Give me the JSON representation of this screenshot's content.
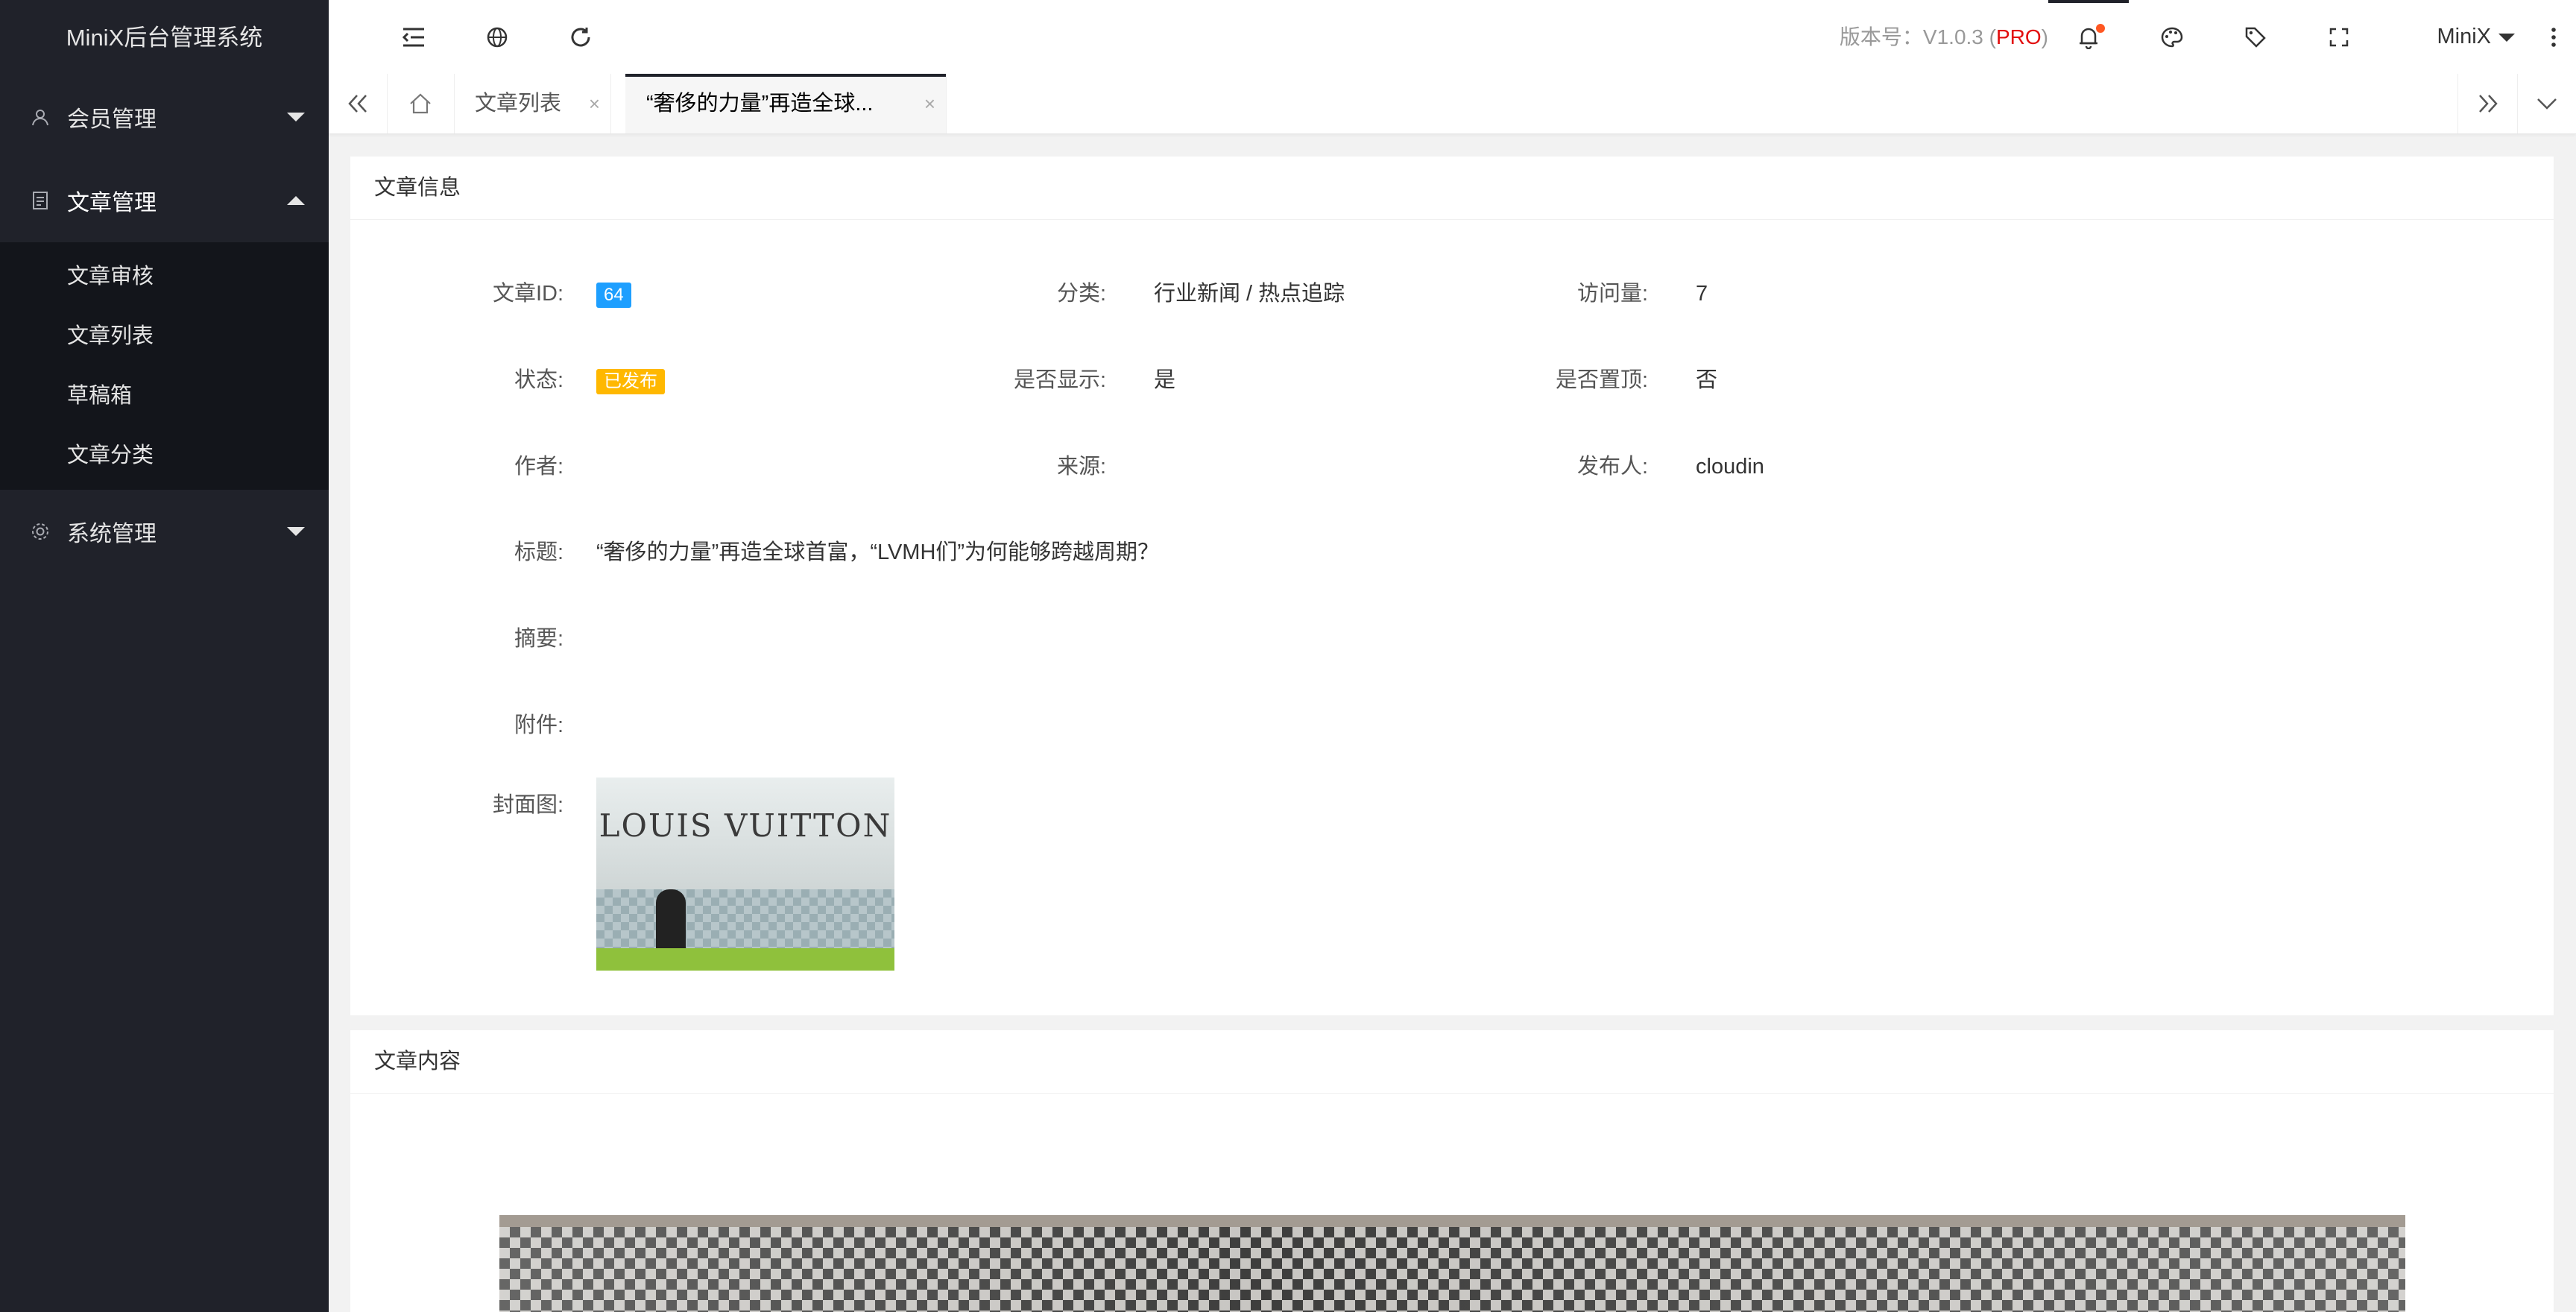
{
  "app": {
    "title": "MiniX后台管理系统"
  },
  "sidebar": {
    "menus": [
      {
        "label": "会员管理",
        "icon": "user-icon",
        "expanded": false
      },
      {
        "label": "文章管理",
        "icon": "document-icon",
        "expanded": true,
        "children": [
          "文章审核",
          "文章列表",
          "草稿箱",
          "文章分类"
        ]
      },
      {
        "label": "系统管理",
        "icon": "gear-icon",
        "expanded": false
      }
    ]
  },
  "header": {
    "version_label": "版本号：",
    "version_number": "V1.0.3 (",
    "version_pro": "PRO",
    "version_close": ")",
    "user_name": "MiniX",
    "notification_dot_color": "#ff5722"
  },
  "tabs": {
    "items": [
      {
        "label": "文章列表",
        "close": "×",
        "active": false
      },
      {
        "label": "“奢侈的力量”再造全球...",
        "close": "×",
        "active": true
      }
    ]
  },
  "article_info": {
    "title": "文章信息",
    "fields": {
      "id": {
        "label": "文章ID:",
        "value": "64"
      },
      "category": {
        "label": "分类:",
        "value": "行业新闻 / 热点追踪"
      },
      "views": {
        "label": "访问量:",
        "value": "7"
      },
      "status": {
        "label": "状态:",
        "value": "已发布"
      },
      "show": {
        "label": "是否显示:",
        "value": "是"
      },
      "top": {
        "label": "是否置顶:",
        "value": "否"
      },
      "author": {
        "label": "作者:",
        "value": ""
      },
      "source": {
        "label": "来源:",
        "value": ""
      },
      "publisher": {
        "label": "发布人:",
        "value": "cloudin"
      },
      "headline": {
        "label": "标题:",
        "value": "“奢侈的力量”再造全球首富，“LVMH们”为何能够跨越周期？"
      },
      "summary": {
        "label": "摘要:",
        "value": ""
      },
      "attachment": {
        "label": "附件:",
        "value": ""
      },
      "cover": {
        "label": "封面图:",
        "sign_text": "LOUIS VUITTON"
      }
    }
  },
  "article_content": {
    "title": "文章内容"
  },
  "colors": {
    "sidebar_bg": "#20222a",
    "accent_blue": "#1e9fff",
    "accent_orange": "#ffb800",
    "pro_red": "#e20e0e"
  }
}
